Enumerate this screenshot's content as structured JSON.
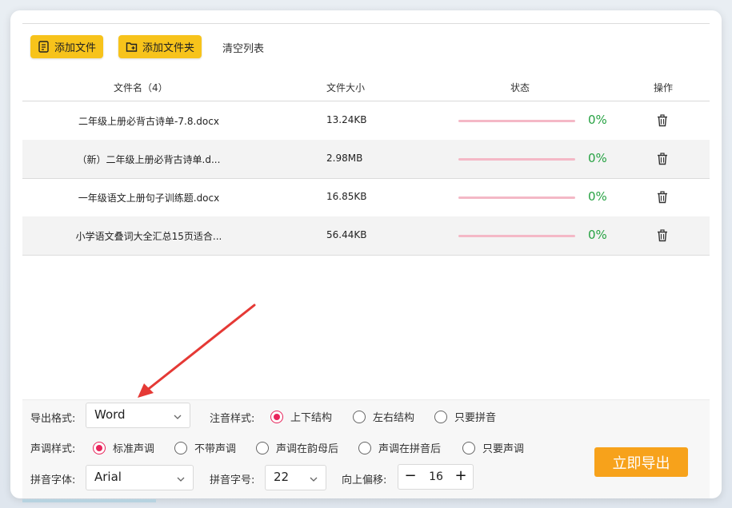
{
  "toolbar": {
    "add_file_label": "添加文件",
    "add_folder_label": "添加文件夹",
    "clear_list_label": "清空列表"
  },
  "table": {
    "headers": {
      "name": "文件名（4）",
      "size": "文件大小",
      "status": "状态",
      "action": "操作"
    },
    "rows": [
      {
        "name": "二年级上册必背古诗单-7.8.docx",
        "size": "13.24KB",
        "progress": "0%"
      },
      {
        "name": "（新）二年级上册必背古诗单.d...",
        "size": "2.98MB",
        "progress": "0%"
      },
      {
        "name": "一年级语文上册句子训练题.docx",
        "size": "16.85KB",
        "progress": "0%"
      },
      {
        "name": "小学语文叠词大全汇总15页适合...",
        "size": "56.44KB",
        "progress": "0%"
      }
    ]
  },
  "settings": {
    "export_format_label": "导出格式:",
    "export_format_value": "Word",
    "annotation_style_label": "注音样式:",
    "annotation_options": [
      "上下结构",
      "左右结构",
      "只要拼音"
    ],
    "annotation_selected": "上下结构",
    "tone_style_label": "声调样式:",
    "tone_options": [
      "标准声调",
      "不带声调",
      "声调在韵母后",
      "声调在拼音后",
      "只要声调"
    ],
    "tone_selected": "标准声调",
    "pinyin_font_label": "拼音字体:",
    "pinyin_font_value": "Arial",
    "pinyin_size_label": "拼音字号:",
    "pinyin_size_value": "22",
    "offset_label": "向上偏移:",
    "offset_value": "16",
    "export_now_label": "立即导出"
  },
  "colors": {
    "accent_yellow": "#f7c31b",
    "export_orange": "#f7a21b",
    "radio_pink": "#e8245b",
    "progress_green": "#27a243",
    "annotation_arrow_red": "#e53935"
  }
}
